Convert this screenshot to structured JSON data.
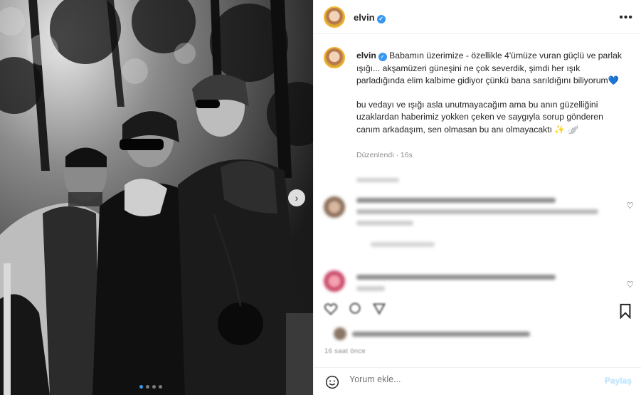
{
  "header": {
    "username": "elvin",
    "verified": true
  },
  "caption": {
    "username": "elvin",
    "paragraph1": "Babamın üzerimize - özellikle 4'ümüze vuran güçlü ve parlak ışığı... akşamüzeri güneşini ne çok severdik, şimdi her ışık parladığında elim kalbime gidiyor çünkü bana sarıldığını biliyorum",
    "paragraph1_emoji": "💙",
    "paragraph2": "bu vedayı ve ışığı asla unutmayacağım ama bu anın güzelliğini uzaklardan haberimiz yokken çeken ve saygıyla sorup gönderen canım arkadaşım, sen olmasan bu anı olmayacaktı",
    "paragraph2_emoji": "✨ 🪽",
    "edited_label": "Düzenlendi",
    "age": "16s"
  },
  "time_ago": "16 saat önce",
  "comment_box": {
    "placeholder": "Yorum ekle...",
    "post_label": "Paylaş"
  },
  "carousel": {
    "total": 4,
    "active_index": 0
  },
  "icons": {
    "more": "more-options-icon",
    "like": "heart-icon",
    "comment": "comment-icon",
    "share": "share-icon",
    "save": "bookmark-icon",
    "emoji": "emoji-icon",
    "next": "chevron-right-icon"
  },
  "colors": {
    "verified": "#3897f0",
    "text": "#262626",
    "muted": "#8e8e8e",
    "post_disabled": "#b2dffc"
  }
}
